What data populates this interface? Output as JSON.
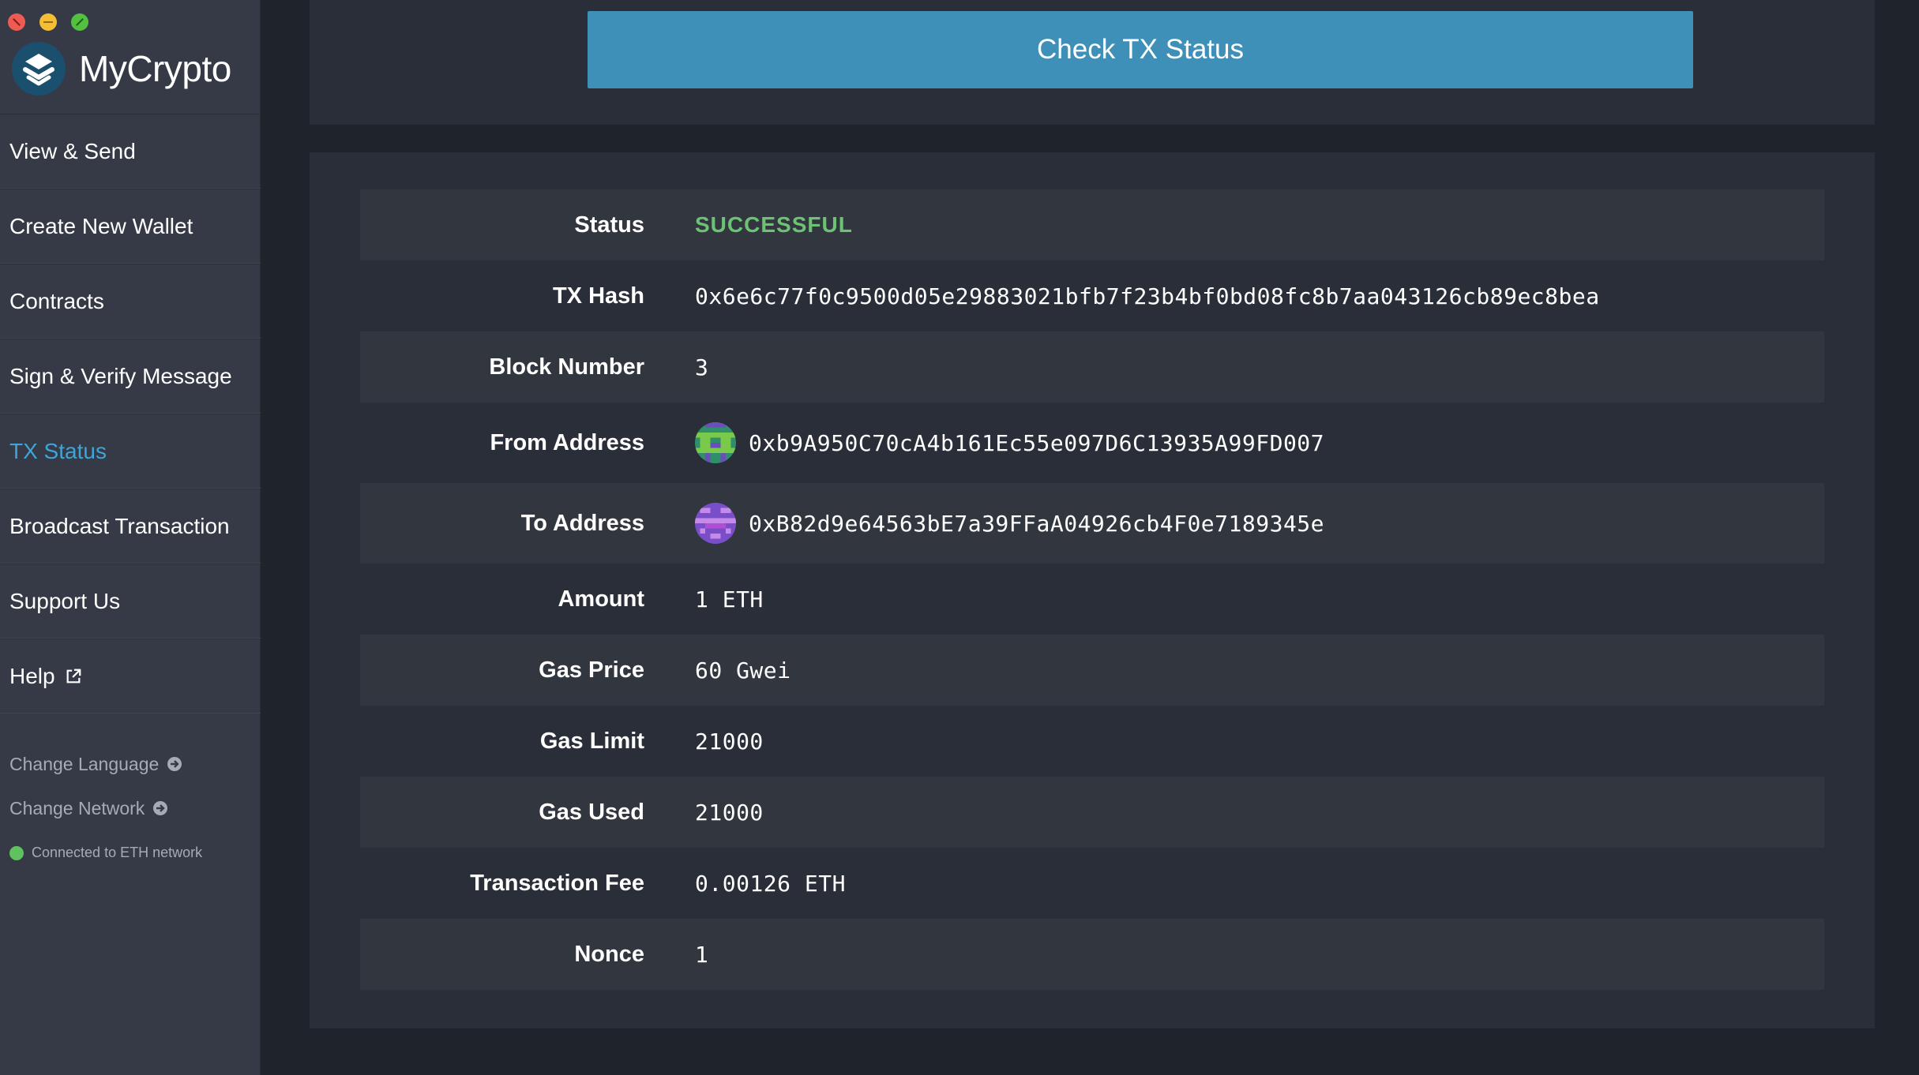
{
  "window": {
    "controls": [
      "close",
      "minimize",
      "maximize"
    ]
  },
  "brand": {
    "name": "MyCrypto",
    "logo_icon": "mycrypto-logo-icon"
  },
  "sidebar": {
    "items": [
      {
        "label": "View & Send"
      },
      {
        "label": "Create New Wallet"
      },
      {
        "label": "Contracts"
      },
      {
        "label": "Sign & Verify Message"
      },
      {
        "label": "TX Status",
        "active": true
      },
      {
        "label": "Broadcast Transaction"
      },
      {
        "label": "Support Us"
      },
      {
        "label": "Help",
        "icon": "external-link-icon"
      }
    ],
    "change_language": "Change Language",
    "change_network": "Change Network",
    "network_status": "Connected to ETH network"
  },
  "main": {
    "check_button_label": "Check TX Status",
    "details": {
      "status": {
        "label": "Status",
        "value": "SUCCESSFUL"
      },
      "tx_hash": {
        "label": "TX Hash",
        "value": "0x6e6c77f0c9500d05e29883021bfb7f23b4bf0bd08fc8b7aa043126cb89ec8bea"
      },
      "block_number": {
        "label": "Block Number",
        "value": "3"
      },
      "from": {
        "label": "From Address",
        "value": "0xb9A950C70cA4b161Ec55e097D6C13935A99FD007"
      },
      "to": {
        "label": "To Address",
        "value": "0xB82d9e64563bE7a39FFaA04926cb4F0e7189345e"
      },
      "amount": {
        "label": "Amount",
        "value": "1 ETH"
      },
      "gas_price": {
        "label": "Gas Price",
        "value": "60 Gwei"
      },
      "gas_limit": {
        "label": "Gas Limit",
        "value": "21000"
      },
      "gas_used": {
        "label": "Gas Used",
        "value": "21000"
      },
      "tx_fee": {
        "label": "Transaction Fee",
        "value": "0.00126 ETH"
      },
      "nonce": {
        "label": "Nonce",
        "value": "1"
      }
    }
  },
  "colors": {
    "accent": "#3fa4d8",
    "button": "#3f90b9",
    "success": "#6cc374",
    "sidebar_bg": "#353a46",
    "main_bg": "#1f232b",
    "panel_bg": "#2a2e38"
  }
}
